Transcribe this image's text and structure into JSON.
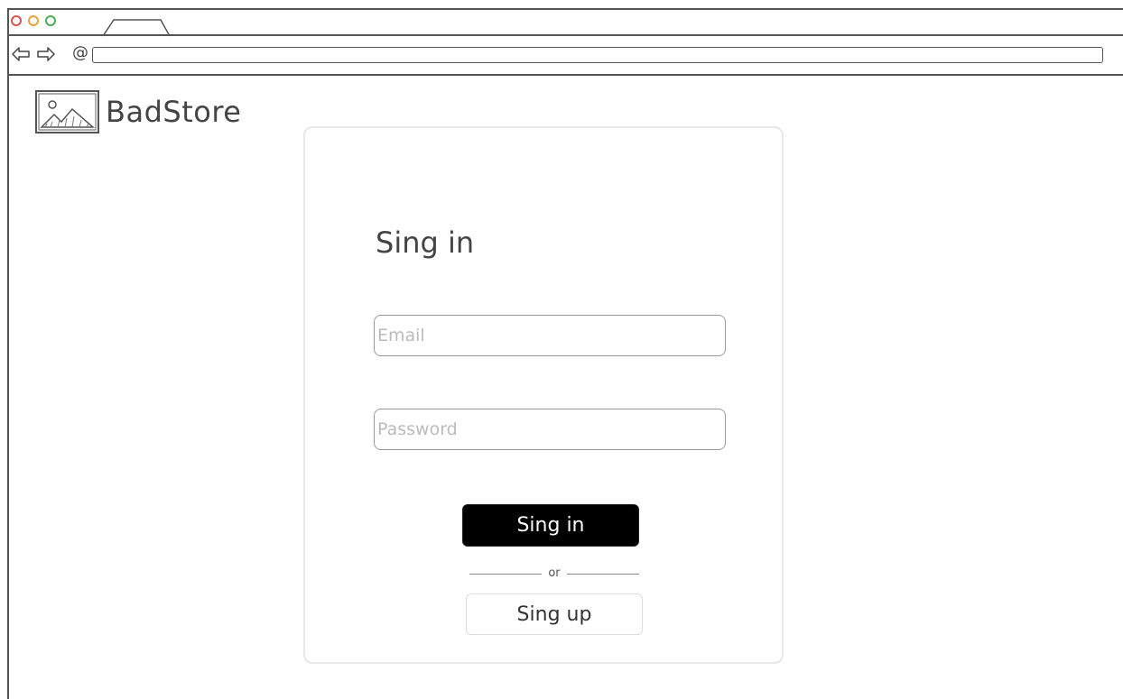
{
  "brand": {
    "name": "BadStore",
    "logo_icon": "image-placeholder-icon"
  },
  "browser": {
    "address_value": "",
    "at_icon": "@"
  },
  "signin": {
    "title": "Sing in",
    "email_placeholder": "Email",
    "password_placeholder": "Password",
    "submit_label": "Sing in",
    "divider_text": "or",
    "signup_label": "Sing up"
  },
  "colors": {
    "primary_button_bg": "#000000",
    "primary_button_text": "#ffffff",
    "close_dot": "#d9534f",
    "minimize_dot": "#e8a33a",
    "maximize_dot": "#4caf50"
  }
}
